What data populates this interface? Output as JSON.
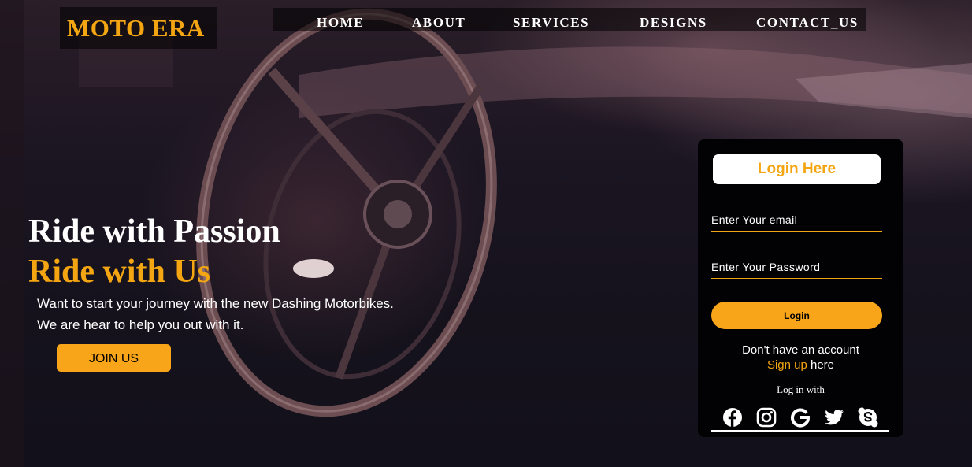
{
  "brand": {
    "logo_text": "MOTO ERA",
    "accent_color": "#f3a512",
    "button_color": "#f8a51a"
  },
  "nav": {
    "items": [
      {
        "label": "HOME"
      },
      {
        "label": "ABOUT"
      },
      {
        "label": "SERVICES"
      },
      {
        "label": "DESIGNS"
      },
      {
        "label": "CONTACT_US"
      }
    ]
  },
  "hero": {
    "line1": "Ride with Passion",
    "line2": "Ride with Us",
    "desc1": "Want to start your journey with the new Dashing Motorbikes.",
    "desc2": "We are hear to help you out with it.",
    "join_label": "JOIN US"
  },
  "login": {
    "title": "Login Here",
    "email_placeholder": "Enter Your email",
    "password_placeholder": "Enter Your Password",
    "button_label": "Login",
    "no_account_text": "Don't have an account",
    "signup_link": "Sign up",
    "here_text": "here",
    "login_with_text": "Log in with",
    "social_icons": [
      "facebook-icon",
      "instagram-icon",
      "google-icon",
      "twitter-icon",
      "skype-icon"
    ]
  }
}
